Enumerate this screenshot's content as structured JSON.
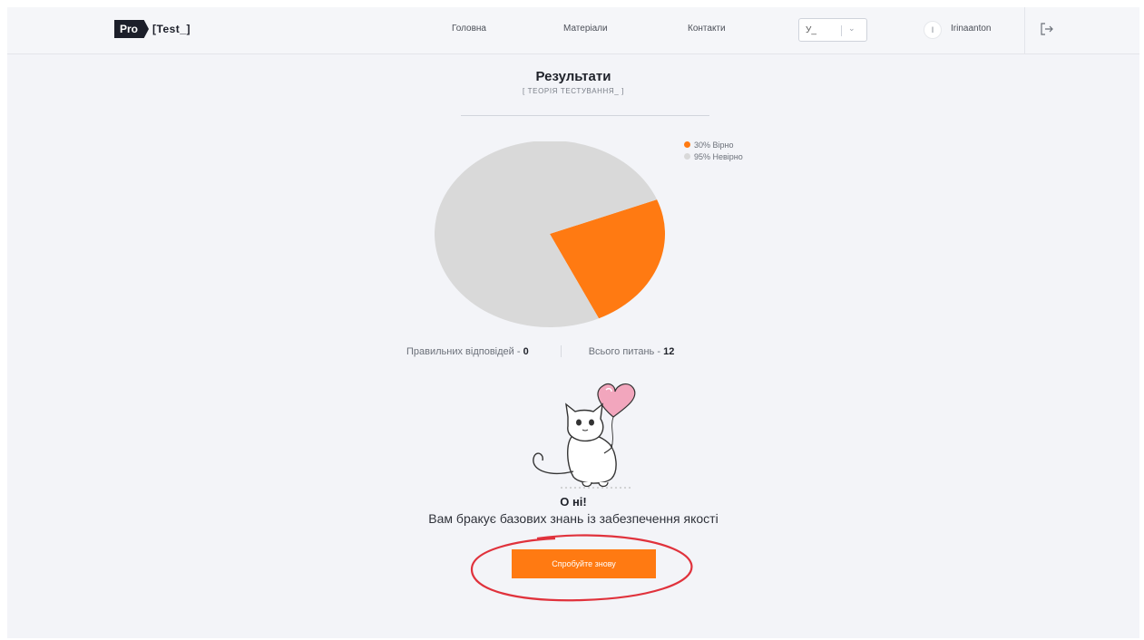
{
  "header": {
    "logo_pro": "Pro",
    "logo_test": "[Test_]",
    "nav": {
      "home": "Головна",
      "materials": "Матеріали",
      "contacts": "Контакти"
    },
    "language_select": {
      "value": "У_",
      "icon": "chevron-down-icon"
    },
    "user": {
      "avatar_text": "I",
      "username": "Irinaanton"
    },
    "logout_icon": "logout-icon"
  },
  "results": {
    "title": "Результати",
    "subtitle": "[ ТЕОРІЯ ТЕСТУВАННЯ_ ]"
  },
  "chart_data": {
    "type": "pie",
    "slices": [
      {
        "label": "Вірно",
        "value": 30,
        "color": "#ff7a12"
      },
      {
        "label": "Невірно",
        "value": 95,
        "color": "#d9d9d9"
      }
    ],
    "legend": [
      "30% Вірно",
      "95% Невірно"
    ],
    "legend_position": "top-right"
  },
  "stats": {
    "correct_label": "Правильних відповідей - ",
    "correct_value": "0",
    "total_label": "Всього питань - ",
    "total_value": "12"
  },
  "illustration": {
    "icon": "cat-with-heart-balloon-illustration"
  },
  "message": {
    "title": "О ні!",
    "text": "Вам бракує базових знань із забезпечення якості"
  },
  "retry_button": {
    "label": "Спробуйте знову"
  },
  "colors": {
    "accent": "#ff7a12",
    "annotation": "#e0323c"
  }
}
